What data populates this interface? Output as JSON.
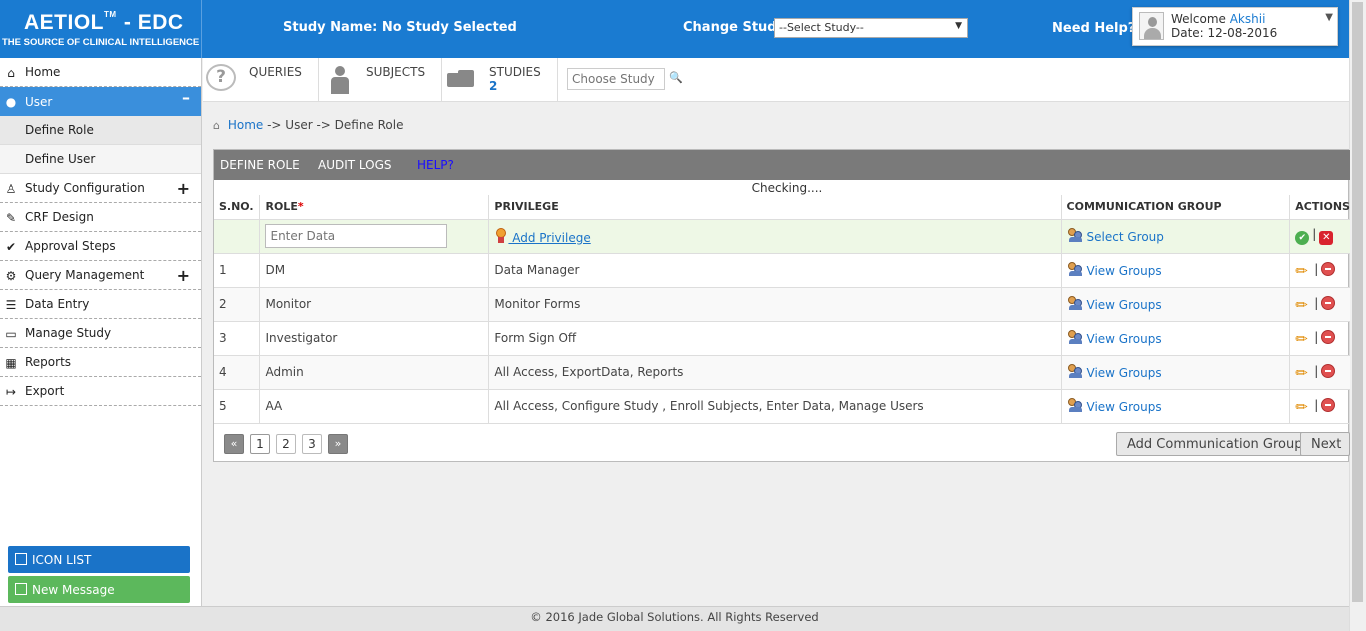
{
  "header": {
    "logo_title": "AETIOL",
    "logo_tm": "TM",
    "logo_suffix": " - EDC",
    "logo_tagline": "THE SOURCE OF CLINICAL INTELLIGENCE",
    "study_name": "Study Name: No Study Selected",
    "change_study_label": "Change Study:",
    "study_select_value": "--Select Study--",
    "need_help": "Need Help?",
    "welcome_label": "Welcome",
    "user_name": "Akshii",
    "date_text": "Date: 12-08-2016",
    "brand_color": "#1a7bd1"
  },
  "sidebar": {
    "items": [
      {
        "label": "Home",
        "icon": "home-icon"
      },
      {
        "label": "User",
        "icon": "user-icon",
        "toggle": "–"
      },
      {
        "label": "Define Role"
      },
      {
        "label": "Define User"
      },
      {
        "label": "Study Configuration",
        "icon": "study-config-icon",
        "toggle": "+"
      },
      {
        "label": "CRF Design",
        "icon": "crf-design-icon"
      },
      {
        "label": "Approval Steps",
        "icon": "approval-icon"
      },
      {
        "label": "Query Management",
        "icon": "query-icon",
        "toggle": "+"
      },
      {
        "label": "Data Entry",
        "icon": "data-entry-icon"
      },
      {
        "label": "Manage Study",
        "icon": "manage-study-icon"
      },
      {
        "label": "Reports",
        "icon": "reports-icon"
      },
      {
        "label": "Export",
        "icon": "export-icon"
      }
    ],
    "icon_list_label": "ICON LIST",
    "new_message_label": "New Message"
  },
  "toolbar": {
    "queries_label": "QUERIES",
    "subjects_label": "SUBJECTS",
    "studies_label": "STUDIES",
    "studies_count": "2",
    "choose_study_placeholder": "Choose Study"
  },
  "breadcrumb": {
    "home": "Home",
    "rest": " -> User -> Define Role"
  },
  "panel": {
    "tabs": {
      "define_role": "DEFINE ROLE",
      "audit_logs": "AUDIT LOGS",
      "help": "HELP?"
    },
    "status_text": "Checking....",
    "columns": {
      "sno": "S.NO.",
      "role": "ROLE",
      "role_required": "*",
      "privilege": "PRIVILEGE",
      "comm_group": "COMMUNICATION GROUP",
      "actions": "ACTIONS"
    },
    "new_row": {
      "role_placeholder": "Enter Data",
      "add_privilege": " Add Privilege",
      "select_group": "Select Group"
    },
    "rows": [
      {
        "sno": "1",
        "role": "DM",
        "privilege": "Data Manager",
        "group": "View Groups"
      },
      {
        "sno": "2",
        "role": "Monitor",
        "privilege": "Monitor Forms",
        "group": "View Groups"
      },
      {
        "sno": "3",
        "role": "Investigator",
        "privilege": "Form Sign Off",
        "group": "View Groups"
      },
      {
        "sno": "4",
        "role": "Admin",
        "privilege": "All Access, ExportData, Reports",
        "group": "View Groups"
      },
      {
        "sno": "5",
        "role": "AA",
        "privilege": "All Access, Configure Study , Enroll Subjects, Enter Data, Manage Users",
        "group": "View Groups"
      }
    ],
    "pager": {
      "prev": "«",
      "pages": [
        "1",
        "2",
        "3"
      ],
      "next": "»"
    },
    "add_comm_group_label": "Add Communication Group",
    "next_label": "Next"
  },
  "footer": {
    "text": "© 2016 Jade Global Solutions. All Rights Reserved"
  }
}
